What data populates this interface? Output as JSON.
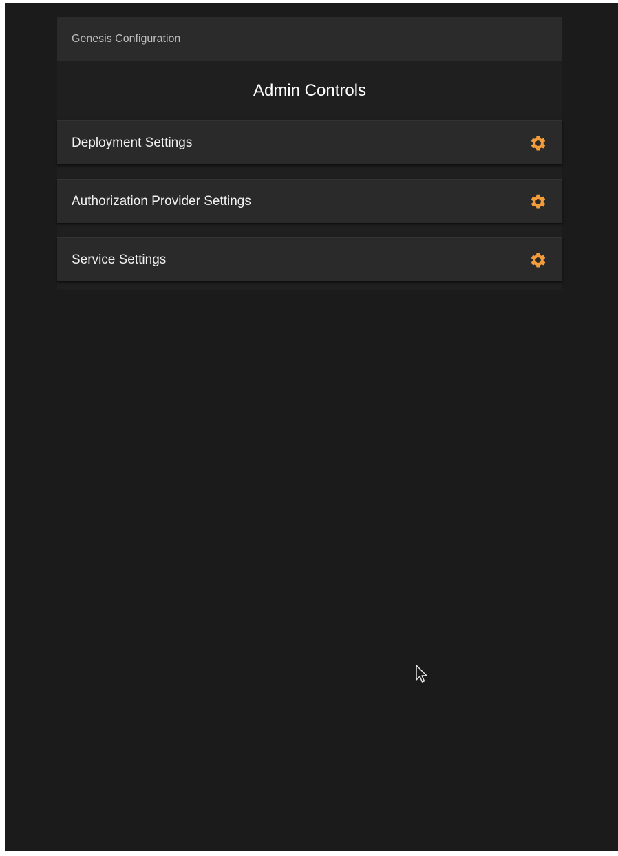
{
  "panel": {
    "header": "Genesis Configuration",
    "title": "Admin Controls"
  },
  "settings": [
    {
      "label": "Deployment Settings",
      "icon": "gear-icon"
    },
    {
      "label": "Authorization Provider Settings",
      "icon": "gear-icon"
    },
    {
      "label": "Service Settings",
      "icon": "gear-icon"
    }
  ],
  "colors": {
    "background": "#1b1b1b",
    "header": "#2b2b2b",
    "row": "#2a2a2a",
    "accent": "#f39c3c"
  }
}
